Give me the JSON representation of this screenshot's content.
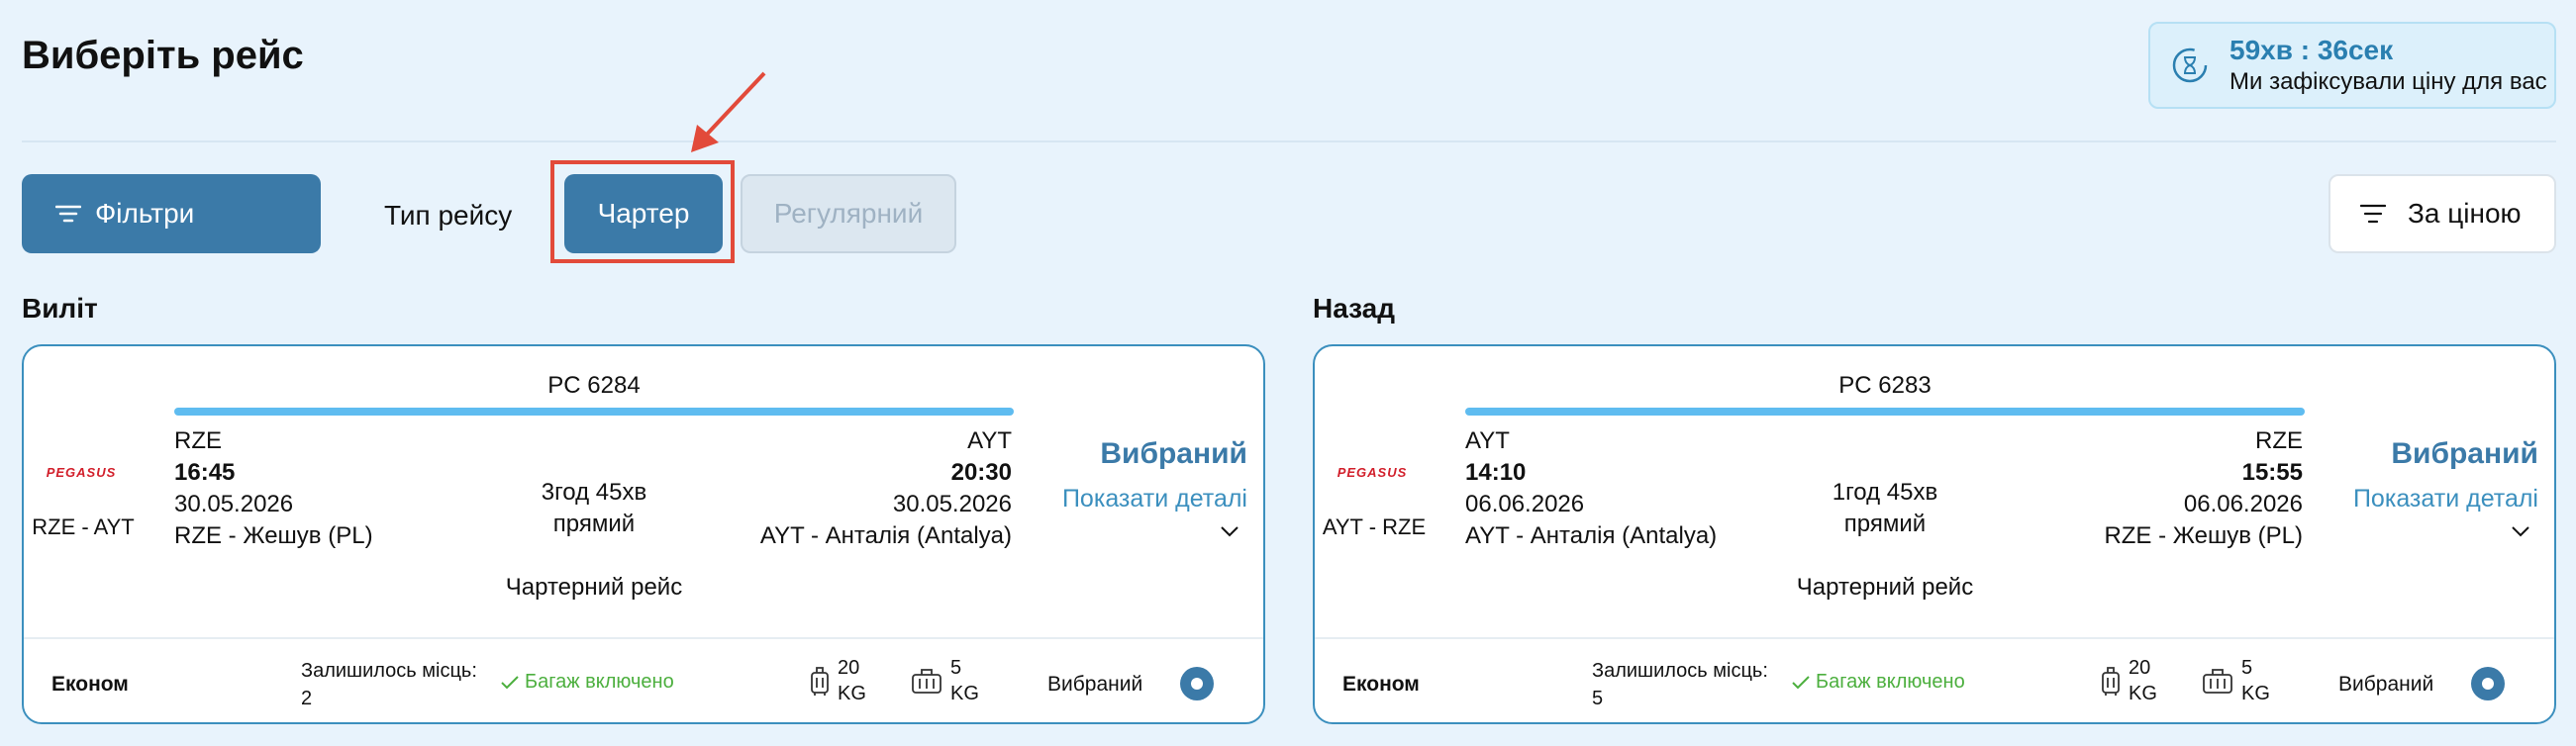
{
  "header": {
    "title": "Виберіть рейс",
    "timer": "59хв : 36сек",
    "timer_note": "Ми зафіксували ціну для вас"
  },
  "toolbar": {
    "filters_label": "Фільтри",
    "trip_type_label": "Тип рейсу",
    "charter_label": "Чартер",
    "regular_label": "Регулярний",
    "sort_label": "За ціною"
  },
  "sections": {
    "outbound_title": "Виліт",
    "return_title": "Назад"
  },
  "colors": {
    "accent": "#3b7aa8",
    "highlight": "#e24a3a",
    "baggage_ok": "#4caf3e"
  },
  "flights": [
    {
      "airline_logo": "PEGASUS",
      "route": "RZE - AYT",
      "flight_no": "PC 6284",
      "from_code": "RZE",
      "dep_time": "16:45",
      "dep_date": "30.05.2026",
      "from_city": "RZE - Жешув (PL)",
      "duration": "3год 45хв",
      "stops": "прямий",
      "to_code": "AYT",
      "arr_time": "20:30",
      "arr_date": "30.05.2026",
      "to_city": "AYT - Анталія (Antalya)",
      "flight_kind": "Чартерний рейс",
      "selected": "Вибраний",
      "details": "Показати деталі",
      "fare_class": "Економ",
      "seats_label": "Залишилось місць:",
      "seats_left": "2",
      "baggage": "Багаж включено",
      "bag_kg": "20",
      "hand_kg": "5",
      "kg_unit": "KG",
      "chosen": "Вибраний"
    },
    {
      "airline_logo": "PEGASUS",
      "route": "AYT - RZE",
      "flight_no": "PC 6283",
      "from_code": "AYT",
      "dep_time": "14:10",
      "dep_date": "06.06.2026",
      "from_city": "AYT - Анталія (Antalya)",
      "duration": "1год 45хв",
      "stops": "прямий",
      "to_code": "RZE",
      "arr_time": "15:55",
      "arr_date": "06.06.2026",
      "to_city": "RZE - Жешув (PL)",
      "flight_kind": "Чартерний рейс",
      "selected": "Вибраний",
      "details": "Показати деталі",
      "fare_class": "Економ",
      "seats_label": "Залишилось місць:",
      "seats_left": "5",
      "baggage": "Багаж включено",
      "bag_kg": "20",
      "hand_kg": "5",
      "kg_unit": "KG",
      "chosen": "Вибраний"
    }
  ]
}
